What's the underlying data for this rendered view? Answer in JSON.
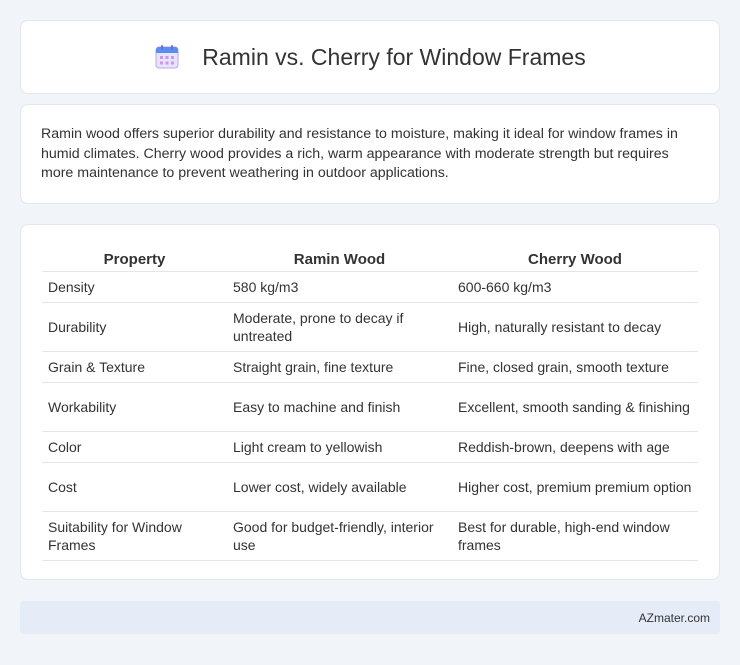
{
  "header": {
    "title": "Ramin vs. Cherry for Window Frames",
    "icon": "calendar-icon"
  },
  "summary": {
    "text": "Ramin wood offers superior durability and resistance to moisture, making it ideal for window frames in humid climates. Cherry wood provides a rich, warm appearance with moderate strength but requires more maintenance to prevent weathering in outdoor applications."
  },
  "table": {
    "headers": [
      "Property",
      "Ramin Wood",
      "Cherry Wood"
    ],
    "rows": [
      [
        "Density",
        "580 kg/m3",
        "600-660 kg/m3"
      ],
      [
        "Durability",
        "Moderate, prone to decay if untreated",
        "High, naturally resistant to decay"
      ],
      [
        "Grain & Texture",
        "Straight grain, fine texture",
        "Fine, closed grain, smooth texture"
      ],
      [
        "Workability",
        "Easy to machine and finish",
        "Excellent, smooth sanding & finishing"
      ],
      [
        "Color",
        "Light cream to yellowish",
        "Reddish-brown, deepens with age"
      ],
      [
        "Cost",
        "Lower cost, widely available",
        "Higher cost, premium premium option"
      ],
      [
        "Suitability for Window Frames",
        "Good for budget-friendly, interior use",
        "Best for durable, high-end window frames"
      ]
    ]
  },
  "footer": {
    "brand": "AZmater.com"
  }
}
